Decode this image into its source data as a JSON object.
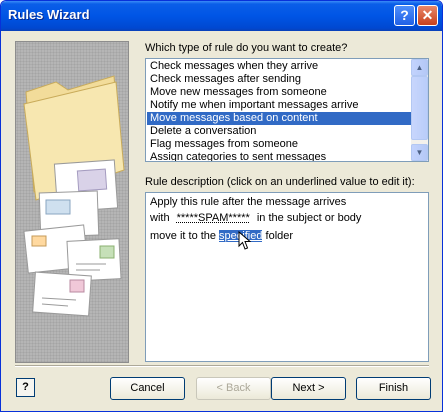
{
  "window": {
    "title": "Rules Wizard",
    "help_glyph": "?",
    "close_glyph": "✕"
  },
  "rule_type": {
    "prompt": "Which type of rule do you want to create?",
    "items": [
      "Check messages when they arrive",
      "Check messages after sending",
      "Move new messages from someone",
      "Notify me when important messages arrive",
      "Move messages based on content",
      "Delete a conversation",
      "Flag messages from someone",
      "Assign categories to sent messages"
    ],
    "selected_index": 4
  },
  "description": {
    "prompt": "Rule description (click on an underlined value to edit it):",
    "line1": "Apply this rule after the message arrives",
    "line2_prefix": "with",
    "line2_link": "*****SPAM*****",
    "line2_suffix": "in the subject or body",
    "line3_prefix": "move it to the",
    "line3_link": "specified",
    "line3_suffix": "folder"
  },
  "buttons": {
    "help_icon": "?",
    "cancel": "Cancel",
    "back": "< Back",
    "next": "Next >",
    "finish": "Finish"
  }
}
